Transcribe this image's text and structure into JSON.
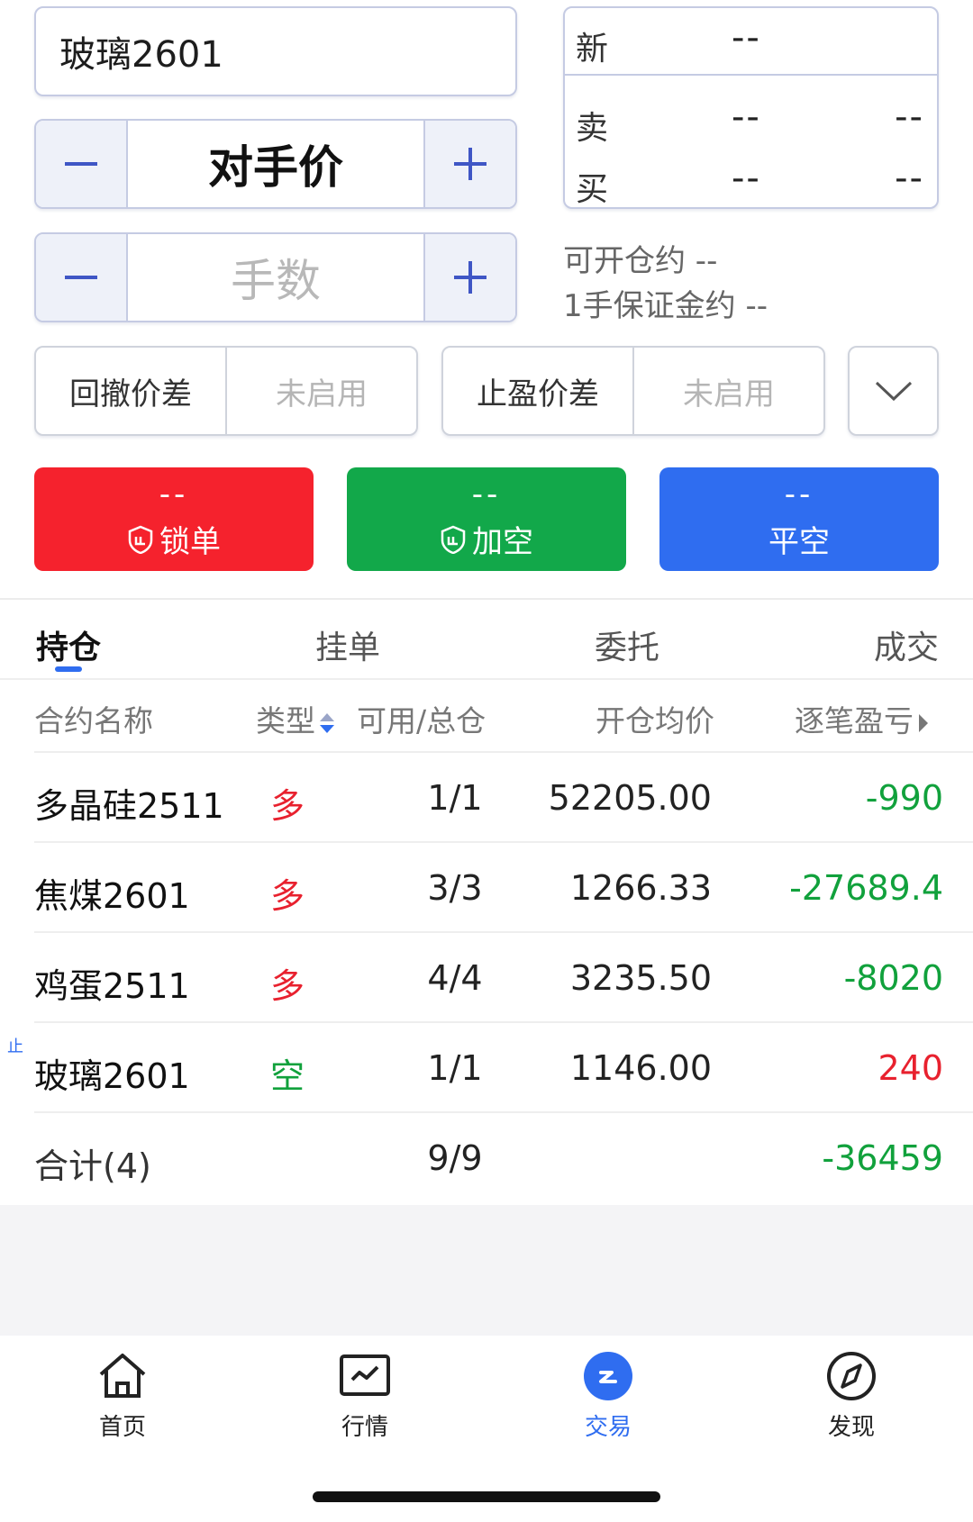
{
  "instrument": "玻璃2601",
  "quote": {
    "new_label": "新",
    "new_value": "--",
    "sell_label": "卖",
    "sell_price": "--",
    "sell_vol": "--",
    "buy_label": "买",
    "buy_price": "--",
    "buy_vol": "--"
  },
  "price_stepper": {
    "minus": "−",
    "value": "对手价",
    "plus": "+"
  },
  "lots_stepper": {
    "minus": "−",
    "placeholder": "手数",
    "plus": "+"
  },
  "info": {
    "can_open": "可开仓约 --",
    "margin": "1手保证金约 --"
  },
  "trail_spread": {
    "label": "回撤价差",
    "value": "未启用"
  },
  "tp_spread": {
    "label": "止盈价差",
    "value": "未启用"
  },
  "actions": [
    {
      "value": "--",
      "label": "锁单"
    },
    {
      "value": "--",
      "label": "加空"
    },
    {
      "value": "--",
      "label": "平空"
    }
  ],
  "tabs": [
    "持仓",
    "挂单",
    "委托",
    "成交"
  ],
  "table": {
    "headers": [
      "合约名称",
      "类型",
      "可用/总仓",
      "开仓均价",
      "逐笔盈亏"
    ],
    "rows": [
      {
        "name": "多晶硅2511",
        "type": "多",
        "avail": "1/1",
        "avg": "52205.00",
        "pnl": "-990"
      },
      {
        "name": "焦煤2601",
        "type": "多",
        "avail": "3/3",
        "avg": "1266.33",
        "pnl": "-27689.4"
      },
      {
        "name": "鸡蛋2511",
        "type": "多",
        "avail": "4/4",
        "avg": "3235.50",
        "pnl": "-8020"
      },
      {
        "name": "玻璃2601",
        "type": "空",
        "avail": "1/1",
        "avg": "1146.00",
        "pnl": "240",
        "tag": "止"
      }
    ],
    "total": {
      "label": "合计(4)",
      "avail": "9/9",
      "pnl": "-36459"
    }
  },
  "nav": [
    {
      "label": "首页",
      "icon": "home-icon"
    },
    {
      "label": "行情",
      "icon": "chart-icon"
    },
    {
      "label": "交易",
      "icon": "trade-icon"
    },
    {
      "label": "发现",
      "icon": "compass-icon"
    }
  ],
  "colors": {
    "accent": "#2f6df0",
    "red": "#f5222d",
    "green": "#12a84a",
    "border": "#c5cbe3"
  }
}
